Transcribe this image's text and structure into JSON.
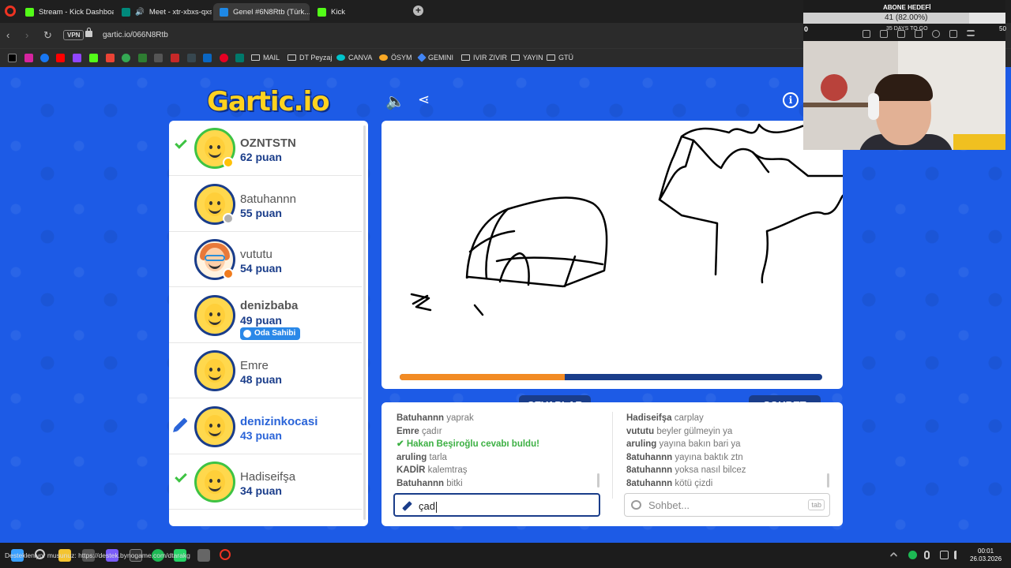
{
  "browser": {
    "tabs": [
      {
        "label": "Stream - Kick Dashboard",
        "color": "#53fc18"
      },
      {
        "label": "Meet - xtr-xbxs-qxs",
        "color": "#00897b"
      },
      {
        "label": "Genel #6N8Rtb (Türk...",
        "color": "#1e88e5"
      },
      {
        "label": "Kick",
        "color": "#53fc18"
      }
    ],
    "vpn_label": "VPN",
    "url": "gartic.io/066N8Rtb",
    "bookmarks": {
      "mail": "MAIL",
      "dt_peyzaj": "DT Peyzaj",
      "canva": "CANVA",
      "osym": "ÖSYM",
      "gemini": "GEMINI",
      "ivir_zivir": "IVIR ZIVIR",
      "yayin": "YAYIN",
      "gtu": "GTÜ"
    }
  },
  "logo": "Gartic.io",
  "info_label": "i",
  "players": [
    {
      "name": "OZNTSTN",
      "score": "62 puan",
      "status": "check",
      "dot_color": "#ffc107",
      "avatar": "smiley",
      "green": true
    },
    {
      "name": "8atuhannn",
      "score": "55 puan",
      "status": "",
      "dot_color": "#b0b0b0",
      "avatar": "smiley",
      "green": false
    },
    {
      "name": "vututu",
      "score": "54 puan",
      "status": "",
      "dot_color": "#f07c1e",
      "avatar": "girl",
      "green": false
    },
    {
      "name": "denizbaba",
      "score": "49 puan",
      "status": "",
      "dot_color": "",
      "avatar": "smiley",
      "green": false,
      "badge": "Oda Sahibi"
    },
    {
      "name": "Emre",
      "score": "48 puan",
      "status": "",
      "dot_color": "",
      "avatar": "smiley",
      "green": false
    },
    {
      "name": "denizinkocasi",
      "score": "43 puan",
      "status": "drawing",
      "dot_color": "",
      "avatar": "smiley",
      "green": false
    },
    {
      "name": "Hadiseifşa",
      "score": "34 puan",
      "status": "check",
      "dot_color": "",
      "avatar": "smiley",
      "green": true
    }
  ],
  "timer_progress": 0.39,
  "answers": {
    "label": "CEVAPLAR",
    "messages": [
      {
        "who": "Batuhannn",
        "text": "yaprak"
      },
      {
        "who": "Emre",
        "text": "çadır"
      },
      {
        "who": "Hakan Beşiroğlu",
        "text": "cevabı buldu!",
        "correct": true
      },
      {
        "who": "aruling",
        "text": "tarla"
      },
      {
        "who": "KADİR",
        "text": "kalemtraş"
      },
      {
        "who": "Batuhannn",
        "text": "bitki"
      }
    ],
    "input_value": "çad"
  },
  "chat": {
    "label": "SOHBET",
    "messages": [
      {
        "who": "Hadiseifşa",
        "text": "carplay"
      },
      {
        "who": "vututu",
        "text": "beyler gülmeyin ya"
      },
      {
        "who": "aruling",
        "text": "yayına bakın bari ya"
      },
      {
        "who": "8atuhannn",
        "text": "yayına baktık ztn"
      },
      {
        "who": "8atuhannn",
        "text": "yoksa nasıl bilcez"
      },
      {
        "who": "8atuhannn",
        "text": "kötü çizdi"
      }
    ],
    "placeholder": "Sohbet...",
    "tab_hint": "tab"
  },
  "stream_overlay": {
    "goal_title": "ABONE HEDEFİ",
    "goal_text": "41 (82.00%)",
    "goal_progress": 0.82,
    "goal_min": "0",
    "goal_max": "50",
    "days_left": "35 DAYS TO GO"
  },
  "taskbar": {
    "status_url": "Destekleniyor musunuz: https://destek.bynogame.com/dtarakg",
    "time": "00:01",
    "date": "26.03.2026"
  }
}
